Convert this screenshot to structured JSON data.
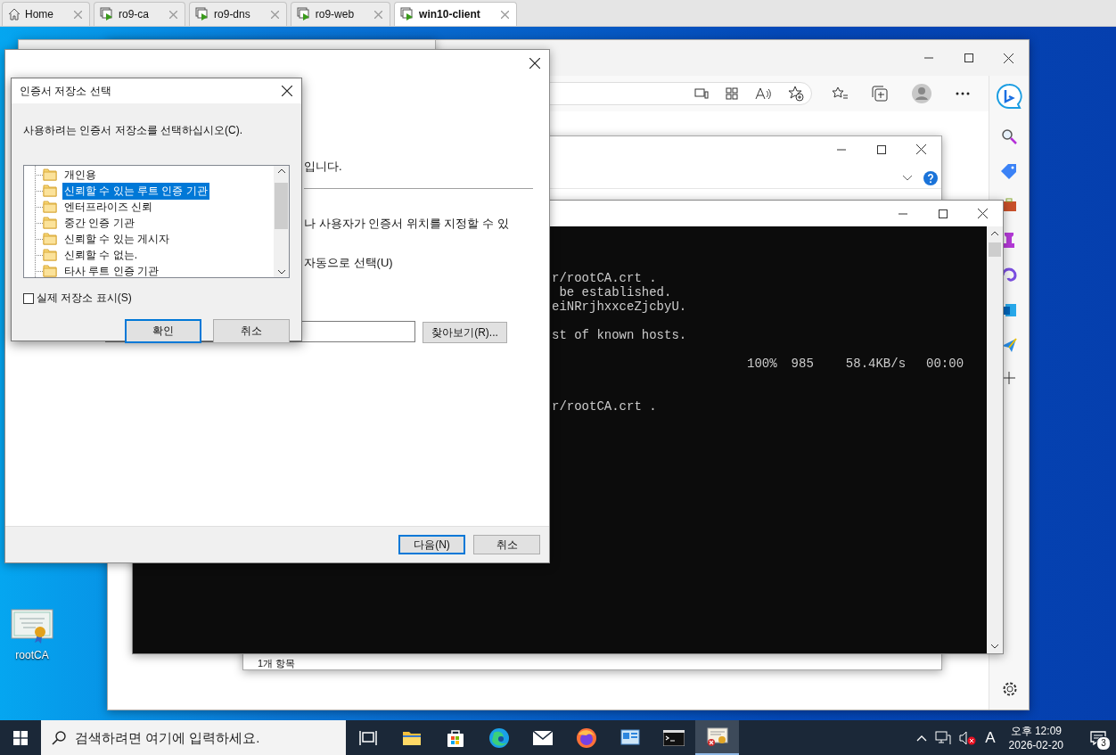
{
  "vm_tabs": [
    {
      "label": "Home",
      "kind": "home",
      "selected": false
    },
    {
      "label": "ro9-ca",
      "kind": "vm",
      "selected": false
    },
    {
      "label": "ro9-dns",
      "kind": "vm",
      "selected": false
    },
    {
      "label": "ro9-web",
      "kind": "vm",
      "selected": false
    },
    {
      "label": "win10-client",
      "kind": "vm",
      "selected": true
    }
  ],
  "desktop_icons": [
    {
      "label": "rootCA"
    }
  ],
  "terminal": {
    "rows": [
      {
        "kind": "text",
        "text": "r/rootCA.crt ."
      },
      {
        "kind": "text",
        "text": " be established."
      },
      {
        "kind": "text",
        "text": "eiNRrjhxxceZjcbyU."
      },
      {
        "kind": "gap"
      },
      {
        "kind": "text",
        "text": "st of known hosts."
      },
      {
        "kind": "gap"
      },
      {
        "kind": "progress",
        "percent": "100%",
        "size": "985",
        "speed": "58.4KB/s",
        "eta": "00:00"
      },
      {
        "kind": "gap"
      },
      {
        "kind": "gap"
      },
      {
        "kind": "text",
        "text": "r/rootCA.crt ."
      }
    ]
  },
  "explorer": {
    "status": "1개 항목"
  },
  "wizard": {
    "lines": [
      "입니다.",
      "나 사용자가 인증서 위치를 지정할 수 있"
    ],
    "option": "자동으로 선택(U)",
    "browse_button": "찾아보기(R)...",
    "buttons": [
      {
        "label": "다음(N)",
        "default": true
      },
      {
        "label": "취소",
        "default": false
      }
    ]
  },
  "cert_store_dialog": {
    "title": "인증서 저장소 선택",
    "prompt": "사용하려는 인증서 저장소를 선택하십시오(C).",
    "stores": [
      {
        "label": "개인용",
        "selected": false
      },
      {
        "label": "신뢰할 수 있는 루트 인증 기관",
        "selected": true
      },
      {
        "label": "엔터프라이즈 신뢰",
        "selected": false
      },
      {
        "label": "중간 인증 기관",
        "selected": false
      },
      {
        "label": "신뢰할 수 있는 게시자",
        "selected": false
      },
      {
        "label": "신뢰할 수 없는.",
        "selected": false
      },
      {
        "label": "타사 루트 인증 기관",
        "selected": false
      }
    ],
    "show_physical": {
      "label": "실제 저장소 표시(S)",
      "checked": false
    },
    "buttons": [
      {
        "label": "확인",
        "default": true
      },
      {
        "label": "취소",
        "default": false
      }
    ]
  },
  "taskbar": {
    "search_placeholder": "검색하려면 여기에 입력하세요.",
    "apps": [
      {
        "kind": "task-view",
        "active": false
      },
      {
        "kind": "folder",
        "active": false
      },
      {
        "kind": "store",
        "active": false
      },
      {
        "kind": "browser",
        "active": false
      },
      {
        "kind": "mail",
        "active": false
      },
      {
        "kind": "globe",
        "active": false
      },
      {
        "kind": "panel",
        "active": false
      },
      {
        "kind": "terminal",
        "active": false
      },
      {
        "kind": "certificate",
        "active": true
      }
    ],
    "ime": "A",
    "time": "오후 12:09",
    "date": "2026-02-20",
    "notification_count": "3"
  }
}
